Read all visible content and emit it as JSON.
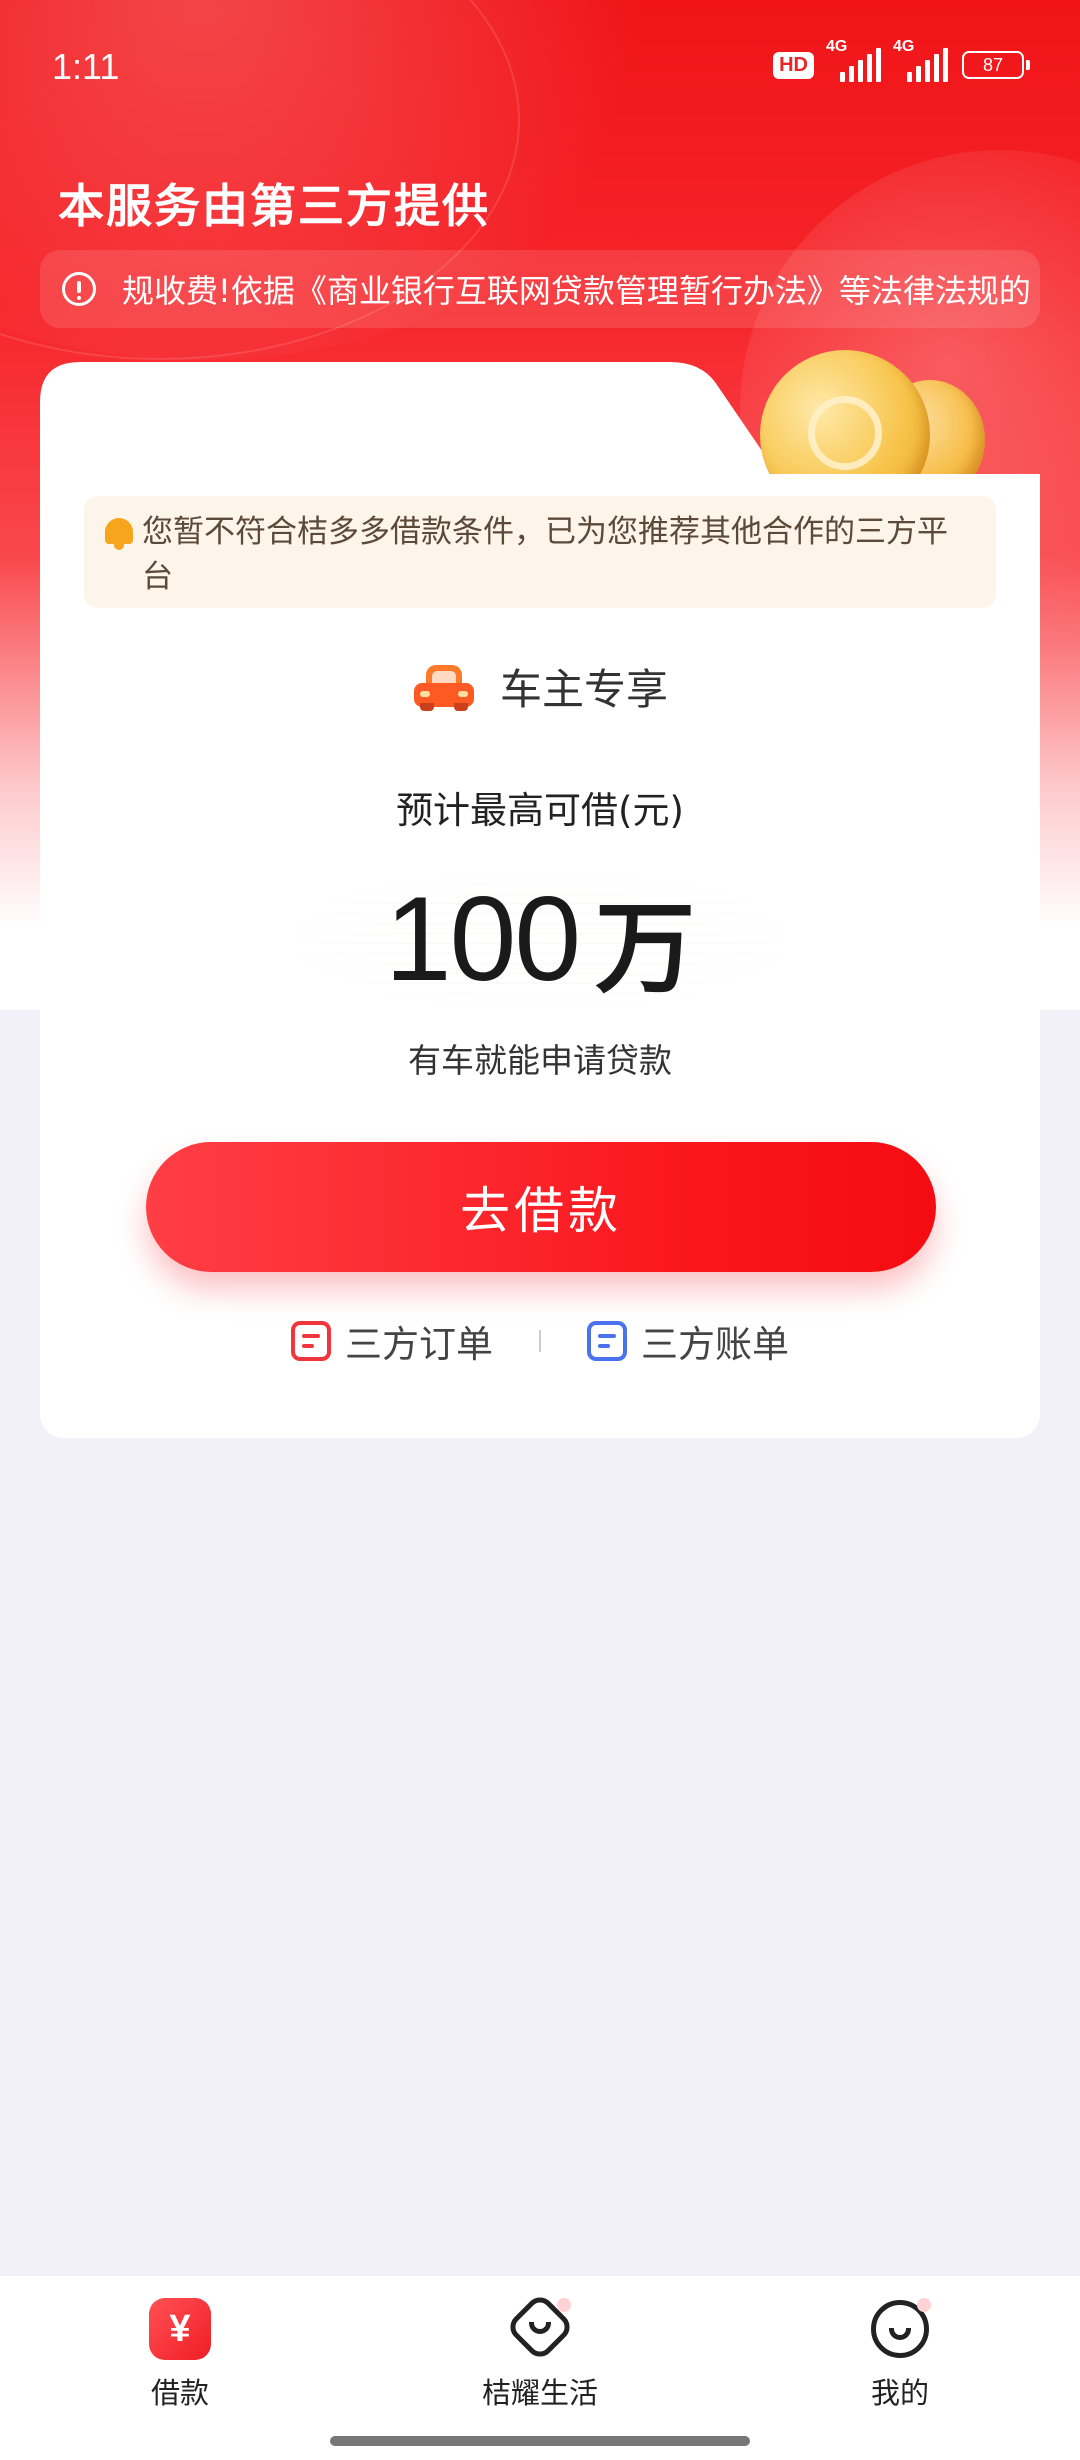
{
  "status_bar": {
    "time": "1:11",
    "hd_badge": "HD",
    "network_1": "4G",
    "network_2": "4G",
    "battery": "87"
  },
  "header": {
    "title": "本服务由第三方提供",
    "notice": "规收费!依据《商业银行互联网贷款管理暂行办法》等法律法规的"
  },
  "card": {
    "warning": "您暂不符合桔多多借款条件，已为您推荐其他合作的三方平台",
    "category": "车主专享",
    "estimate_label": "预计最高可借(元)",
    "amount_number": "100",
    "amount_unit": "万",
    "sub_label": "有车就能申请贷款",
    "borrow_button": "去借款",
    "links": {
      "orders": "三方订单",
      "bills": "三方账单"
    }
  },
  "bottom_nav": {
    "items": [
      {
        "label": "借款",
        "icon": "yen-icon",
        "active": true
      },
      {
        "label": "桔耀生活",
        "icon": "heart-diamond-icon",
        "active": false
      },
      {
        "label": "我的",
        "icon": "smiley-face-icon",
        "active": false
      }
    ]
  },
  "colors": {
    "brand_red": "#f01d24",
    "order_icon": "#f0363c",
    "bill_icon": "#4a72ee",
    "warning_bg": "#fdf4ea"
  }
}
